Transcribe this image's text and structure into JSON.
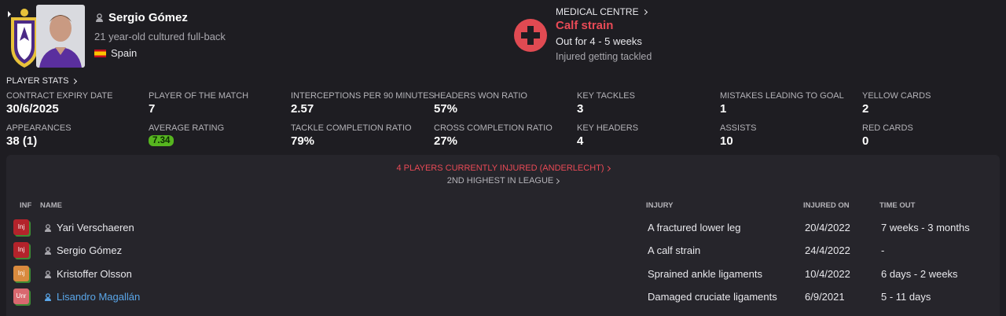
{
  "player": {
    "name": "Sergio Gómez",
    "description": "21 year-old cultured full-back",
    "nationality": "Spain"
  },
  "medical": {
    "title": "MEDICAL CENTRE",
    "injury": "Calf strain",
    "out_for": "Out for 4 - 5 weeks",
    "cause": "Injured getting tackled"
  },
  "stats_title": "PLAYER STATS",
  "stats": [
    {
      "label": "CONTRACT EXPIRY DATE",
      "value": "30/6/2025"
    },
    {
      "label": "PLAYER OF THE MATCH",
      "value": "7"
    },
    {
      "label": "INTERCEPTIONS PER 90 MINUTES",
      "value": "2.57"
    },
    {
      "label": "HEADERS WON RATIO",
      "value": "57%"
    },
    {
      "label": "KEY TACKLES",
      "value": "3"
    },
    {
      "label": "MISTAKES LEADING TO GOAL",
      "value": "1"
    },
    {
      "label": "YELLOW CARDS",
      "value": "2"
    },
    {
      "label": "APPEARANCES",
      "value": "38 (1)"
    },
    {
      "label": "AVERAGE RATING",
      "value": "7.34"
    },
    {
      "label": "TACKLE COMPLETION RATIO",
      "value": "79%"
    },
    {
      "label": "CROSS COMPLETION RATIO",
      "value": "27%"
    },
    {
      "label": "KEY HEADERS",
      "value": "4"
    },
    {
      "label": "ASSISTS",
      "value": "10"
    },
    {
      "label": "RED CARDS",
      "value": "0"
    }
  ],
  "injuries_panel": {
    "count_text": "4 PLAYERS CURRENTLY INJURED (ANDERLECHT)",
    "league_text": "2ND HIGHEST IN LEAGUE",
    "columns": {
      "inf": "INF",
      "name": "NAME",
      "injury": "INJURY",
      "injured_on": "INJURED ON",
      "time_out": "TIME OUT"
    },
    "rows": [
      {
        "badge": "Inj",
        "badge_color": "#b3232b",
        "name": "Yari Verschaeren",
        "injury": "A fractured lower leg",
        "injured_on": "20/4/2022",
        "time_out": "7 weeks - 3 months"
      },
      {
        "badge": "Inj",
        "badge_color": "#b3232b",
        "name": "Sergio Gómez",
        "injury": "A calf strain",
        "injured_on": "24/4/2022",
        "time_out": "-"
      },
      {
        "badge": "Inj",
        "badge_color": "#d98a3e",
        "name": "Kristoffer Olsson",
        "injury": "Sprained ankle ligaments",
        "injured_on": "10/4/2022",
        "time_out": "6 days - 2 weeks"
      },
      {
        "badge": "Unr",
        "badge_color": "#d9686f",
        "name": "Lisandro Magallán",
        "injury": "Damaged cruciate ligaments",
        "injured_on": "6/9/2021",
        "time_out": "5 - 11 days"
      }
    ]
  },
  "colors": {
    "accent_red": "#e94a56",
    "rating_green": "#56b51f",
    "link_blue": "#5aa6e8",
    "background": "#1e1d22"
  }
}
